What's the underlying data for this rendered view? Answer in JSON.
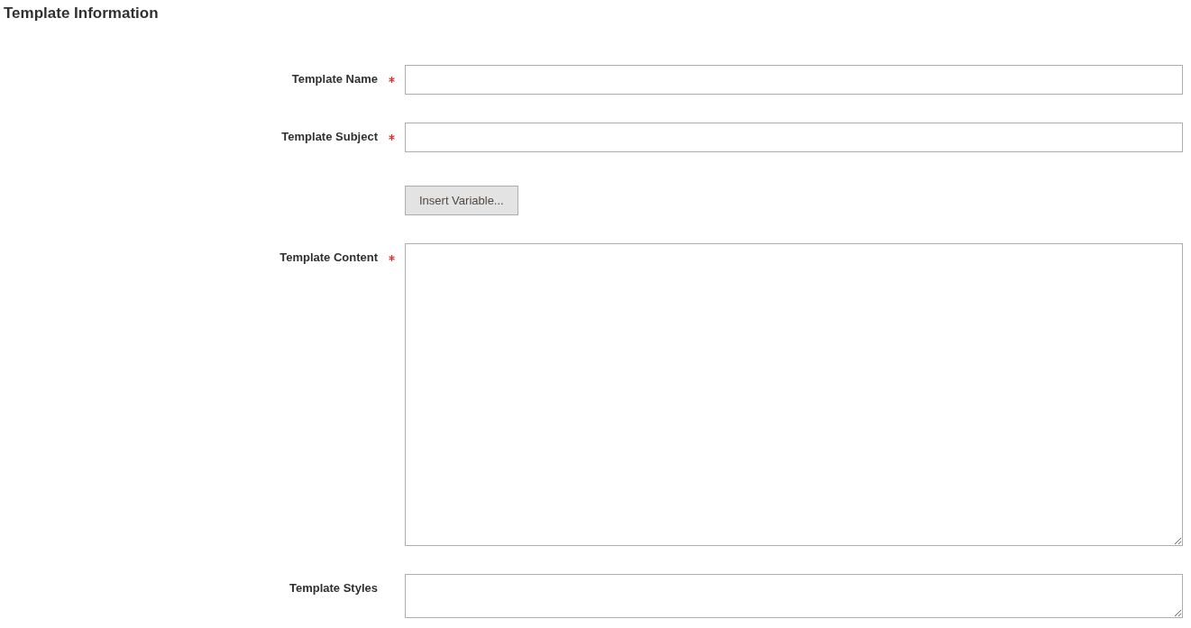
{
  "section_title": "Template Information",
  "fields": [
    {
      "kind": "input",
      "label": "Template Name",
      "required": true
    },
    {
      "kind": "input",
      "label": "Template Subject",
      "required": true
    },
    {
      "kind": "button",
      "label": "Insert Variable..."
    },
    {
      "kind": "editor",
      "label": "Template Content",
      "required": true
    },
    {
      "kind": "textarea",
      "label": "Template Styles",
      "required": false
    }
  ]
}
